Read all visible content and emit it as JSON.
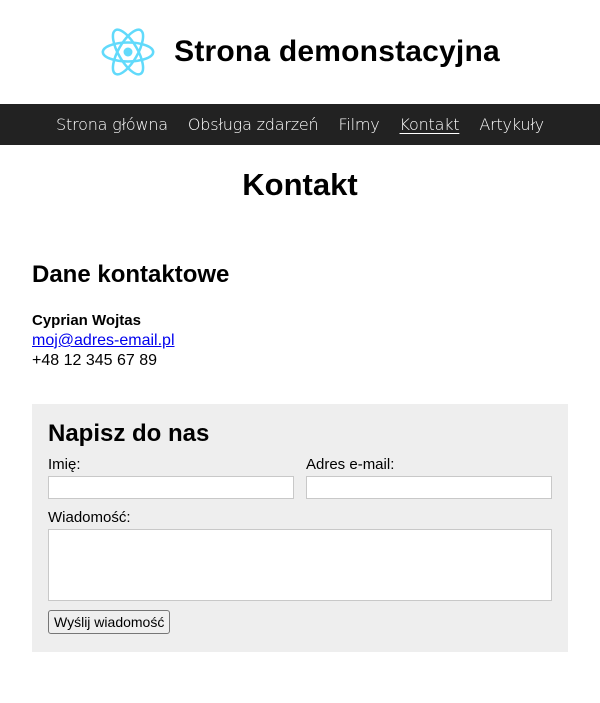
{
  "header": {
    "title": "Strona demonstacyjna",
    "logo_icon": "react-atom-icon",
    "logo_color": "#61dafb"
  },
  "nav": {
    "items": [
      {
        "label": "Strona główna"
      },
      {
        "label": "Obsługa zdarzeń"
      },
      {
        "label": "Filmy"
      },
      {
        "label": "Kontakt",
        "active": true
      },
      {
        "label": "Artykuły"
      }
    ],
    "background": "#222222"
  },
  "page": {
    "heading": "Kontakt"
  },
  "contact": {
    "heading": "Dane kontaktowe",
    "name": "Cyprian Wojtas",
    "email": "moj@adres-email.pl",
    "phone": "+48 12 345 67 89"
  },
  "form": {
    "heading": "Napisz do nas",
    "name_label": "Imię:",
    "name_value": "",
    "email_label": "Adres e-mail:",
    "email_value": "",
    "message_label": "Wiadomość:",
    "message_value": "",
    "submit_label": "Wyślij wiadomość",
    "background": "#eeeeee"
  }
}
